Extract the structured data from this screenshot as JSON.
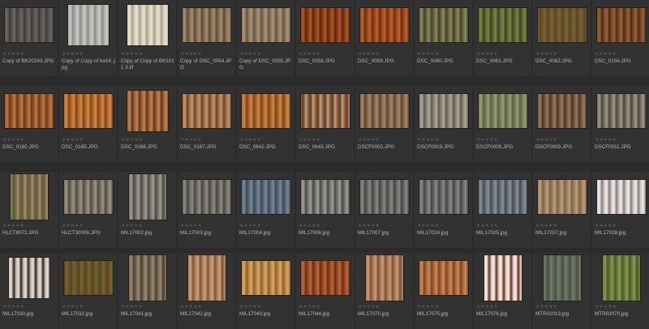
{
  "app": {
    "view": "Thumbnail Browser",
    "rating_glyph": "★★★★★",
    "colors": {
      "background": "#2b2b2b",
      "cell": "#323232",
      "label": "#b8b8b8",
      "stars": "#555555"
    }
  },
  "rows": [
    [
      {
        "label": "Copy of BK20243.JPG",
        "icon": "texture-thumbnail",
        "shape": "landscape",
        "swatch": [
          "#5a5653",
          "#3d3a38",
          "#6b6663"
        ]
      },
      {
        "label": "Copy of Copy of ba16 .jpg",
        "icon": "texture-thumbnail",
        "shape": "square",
        "swatch": [
          "#b6b6b0",
          "#8a8a86",
          "#c9c9c3"
        ]
      },
      {
        "label": "Copy of Copy of BK1011 3.tif",
        "icon": "texture-thumbnail",
        "shape": "square",
        "swatch": [
          "#d8d2bf",
          "#a79f88",
          "#e8e2cf"
        ]
      },
      {
        "label": "Copy of DSC_0054.JPG",
        "icon": "texture-thumbnail",
        "shape": "landscape",
        "swatch": [
          "#8a7256",
          "#5c4a36",
          "#a58d6f"
        ]
      },
      {
        "label": "Copy of DSC_0055.JPG",
        "icon": "texture-thumbnail",
        "shape": "landscape",
        "swatch": [
          "#8f7a62",
          "#655440",
          "#ab967c"
        ]
      },
      {
        "label": "DSC_0058.JPG",
        "icon": "texture-thumbnail",
        "shape": "landscape",
        "swatch": [
          "#8a3f1a",
          "#5b240c",
          "#b35a26"
        ]
      },
      {
        "label": "DSC_0059.JPG",
        "icon": "texture-thumbnail",
        "shape": "landscape",
        "swatch": [
          "#9b4a1e",
          "#6b2e10",
          "#c2652c"
        ]
      },
      {
        "label": "DSC_0060.JPG",
        "icon": "texture-thumbnail",
        "shape": "landscape",
        "swatch": [
          "#6b6a44",
          "#3f3f26",
          "#8c8a5c"
        ]
      },
      {
        "label": "DSC_0061.JPG",
        "icon": "texture-thumbnail",
        "shape": "landscape",
        "swatch": [
          "#5d6a36",
          "#3a421f",
          "#7a8748"
        ]
      },
      {
        "label": "DSC_0062.JPG",
        "icon": "texture-thumbnail",
        "shape": "landscape",
        "swatch": [
          "#6c6a3c",
          "#8a4a24",
          "#4a4a28"
        ]
      },
      {
        "label": "DSC_0156.JPG",
        "icon": "texture-thumbnail",
        "shape": "landscape",
        "swatch": [
          "#7a4a2a",
          "#4a2a16",
          "#9c6438"
        ]
      }
    ],
    [
      {
        "label": "DSC_0160.JPG",
        "icon": "texture-thumbnail",
        "shape": "landscape",
        "swatch": [
          "#9c5a2c",
          "#6a3816",
          "#c07a40"
        ]
      },
      {
        "label": "DSC_0165.JPG",
        "icon": "texture-thumbnail",
        "shape": "landscape",
        "swatch": [
          "#b86a2a",
          "#7e4216",
          "#d68a44"
        ]
      },
      {
        "label": "DSC_0166.JPG",
        "icon": "texture-thumbnail",
        "shape": "square",
        "swatch": [
          "#a0643a",
          "#5c3418",
          "#c48454"
        ]
      },
      {
        "label": "DSC_0167.JPG",
        "icon": "texture-thumbnail",
        "shape": "landscape",
        "swatch": [
          "#a8744a",
          "#6a4426",
          "#c8946a"
        ]
      },
      {
        "label": "DSC_0642.JPG",
        "icon": "texture-thumbnail",
        "shape": "landscape",
        "swatch": [
          "#b0682c",
          "#7a4218",
          "#d28a48"
        ]
      },
      {
        "label": "DSC_0643.JPG",
        "icon": "texture-thumbnail",
        "shape": "landscape",
        "swatch": [
          "#9a5a2a",
          "#a8a8a0",
          "#6a3a18"
        ]
      },
      {
        "label": "DSCF0002.JPG",
        "icon": "texture-thumbnail",
        "shape": "landscape",
        "swatch": [
          "#8a6a4c",
          "#5a4430",
          "#a8896a"
        ]
      },
      {
        "label": "DSCF0003.JPG",
        "icon": "texture-thumbnail",
        "shape": "landscape",
        "swatch": [
          "#8c8676",
          "#5e5a4e",
          "#b0aa98"
        ]
      },
      {
        "label": "DSCF0008.JPG",
        "icon": "texture-thumbnail",
        "shape": "landscape",
        "swatch": [
          "#7a7a5a",
          "#4c6a34",
          "#a09a82"
        ]
      },
      {
        "label": "DSCF0009.JPG",
        "icon": "texture-thumbnail",
        "shape": "landscape",
        "swatch": [
          "#7a5a44",
          "#4a3424",
          "#9c7a62"
        ]
      },
      {
        "label": "DSCF0011.JPG",
        "icon": "texture-thumbnail",
        "shape": "landscape",
        "swatch": [
          "#7a7264",
          "#4a443a",
          "#a09888"
        ]
      }
    ],
    [
      {
        "label": "HLCT8072.JPG",
        "icon": "texture-thumbnail",
        "shape": "portrait",
        "swatch": [
          "#b08a6a",
          "#7a5a42",
          "#4a6a3a"
        ]
      },
      {
        "label": "HLCT30008.JPG",
        "icon": "texture-thumbnail",
        "shape": "landscape",
        "swatch": [
          "#7a7466",
          "#4e4a40",
          "#9c968a"
        ]
      },
      {
        "label": "MIL17002.jpg",
        "icon": "texture-thumbnail",
        "shape": "portrait",
        "swatch": [
          "#7a7670",
          "#4a4640",
          "#a09c96"
        ]
      },
      {
        "label": "MIL17003.jpg",
        "icon": "texture-thumbnail",
        "shape": "landscape",
        "swatch": [
          "#6e6a64",
          "#48443e",
          "#908c86"
        ]
      },
      {
        "label": "MIL17004.jpg",
        "icon": "texture-thumbnail",
        "shape": "landscape",
        "swatch": [
          "#5a6a78",
          "#3a4858",
          "#7a8a98"
        ]
      },
      {
        "label": "MIL17006.jpg",
        "icon": "texture-thumbnail",
        "shape": "landscape",
        "swatch": [
          "#7a7872",
          "#4a4844",
          "#a09e98"
        ]
      },
      {
        "label": "MIL17007.jpg",
        "icon": "texture-thumbnail",
        "shape": "landscape",
        "swatch": [
          "#6a6864",
          "#464440",
          "#8c8a86"
        ]
      },
      {
        "label": "MIL17024.jpg",
        "icon": "texture-thumbnail",
        "shape": "landscape",
        "swatch": [
          "#6a6a6a",
          "#444444",
          "#8a8a8a"
        ]
      },
      {
        "label": "MIL17025.jpg",
        "icon": "texture-thumbnail",
        "shape": "landscape",
        "swatch": [
          "#6a7078",
          "#444a52",
          "#8c929a"
        ]
      },
      {
        "label": "MIL17027.jpg",
        "icon": "texture-thumbnail",
        "shape": "landscape",
        "swatch": [
          "#a08060",
          "#7a6244",
          "#bca07e"
        ]
      },
      {
        "label": "MIL17028.jpg",
        "icon": "texture-thumbnail",
        "shape": "landscape",
        "swatch": [
          "#d0d0d4",
          "#8a7a6a",
          "#eeeef0"
        ]
      }
    ],
    [
      {
        "label": "MIL17030.jpg",
        "icon": "texture-thumbnail",
        "shape": "square",
        "swatch": [
          "#c8c0b4",
          "#2a2420",
          "#e8e0d4"
        ]
      },
      {
        "label": "MIL17032.jpg",
        "icon": "texture-thumbnail",
        "shape": "landscape",
        "swatch": [
          "#6a3a1e",
          "#3a6a2a",
          "#8a5a2e"
        ]
      },
      {
        "label": "MIL17041.jpg",
        "icon": "texture-thumbnail",
        "shape": "portrait",
        "swatch": [
          "#7a6a54",
          "#4a3e30",
          "#9c8c74"
        ]
      },
      {
        "label": "MIL17042.jpg",
        "icon": "texture-thumbnail",
        "shape": "portrait",
        "swatch": [
          "#b48460",
          "#7a5436",
          "#d0a07a"
        ]
      },
      {
        "label": "MIL17043.jpg",
        "icon": "texture-thumbnail",
        "shape": "landscape",
        "swatch": [
          "#c08a44",
          "#8a5e2a",
          "#dca864"
        ]
      },
      {
        "label": "MIL17044.jpg",
        "icon": "texture-thumbnail",
        "shape": "landscape",
        "swatch": [
          "#9a4a24",
          "#6a2e14",
          "#bc6a3a"
        ]
      },
      {
        "label": "MIL17070.jpg",
        "icon": "texture-thumbnail",
        "shape": "portrait",
        "swatch": [
          "#b07a5a",
          "#7a5036",
          "#cc9a78"
        ]
      },
      {
        "label": "MIL17075.jpg",
        "icon": "texture-thumbnail",
        "shape": "landscape",
        "swatch": [
          "#b06a3a",
          "#7a4422",
          "#cc8a58"
        ]
      },
      {
        "label": "MIL17076.jpg",
        "icon": "texture-thumbnail",
        "shape": "portrait",
        "swatch": [
          "#e0d8cc",
          "#6a2a1a",
          "#f4eee4"
        ]
      },
      {
        "label": "MTR02013.jpg",
        "icon": "texture-thumbnail",
        "shape": "portrait",
        "swatch": [
          "#7a7a74",
          "#4a4c46",
          "#5a6a4a"
        ]
      },
      {
        "label": "MTR02070.jpg",
        "icon": "texture-thumbnail",
        "shape": "portrait",
        "swatch": [
          "#6a7a3a",
          "#4a5a24",
          "#8a9a54"
        ]
      }
    ]
  ]
}
